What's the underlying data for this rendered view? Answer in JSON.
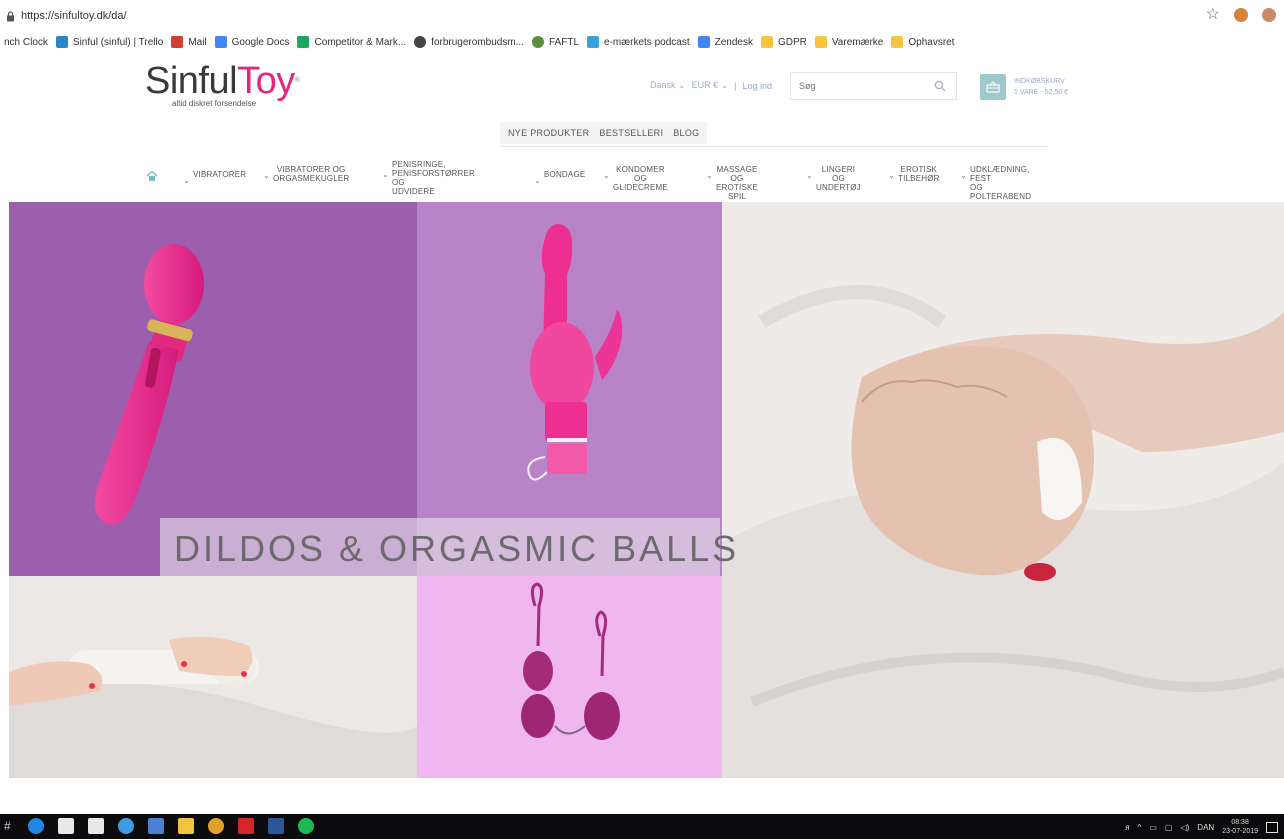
{
  "browser": {
    "url": "https://sinfultoy.dk/da/",
    "bookmarks": [
      {
        "label": "nch Clock",
        "color": "#ffffff"
      },
      {
        "label": "Sinful (sinful) | Trello",
        "color": "#2a85c9"
      },
      {
        "label": "Mail",
        "color": "#d23f31"
      },
      {
        "label": "Google Docs",
        "color": "#4285f4"
      },
      {
        "label": "Competitor & Mark...",
        "color": "#1fa463"
      },
      {
        "label": "forbrugerombudsm...",
        "color": "#444444"
      },
      {
        "label": "FAFTL",
        "color": "#5b8c3a"
      },
      {
        "label": "e-mærkets podcast",
        "color": "#3aa3d6"
      },
      {
        "label": "Zendesk",
        "color": "#4285f4"
      },
      {
        "label": "GDPR",
        "color": "#f5c542"
      },
      {
        "label": "Varemærke",
        "color": "#f5c542"
      },
      {
        "label": "Ophavsret",
        "color": "#f5c542"
      }
    ]
  },
  "header": {
    "logo_part1": "Sinful",
    "logo_part2": "Toy",
    "logo_reg": "®",
    "tagline": "altid diskret forsendelse",
    "language": "Dansk",
    "currency": "EUR €",
    "separator": "|",
    "login": "Log ind",
    "search_placeholder": "Søg",
    "cart_title": "INDKØBSKURV",
    "cart_summary": "1 VARE - 52,50 €"
  },
  "subnav": [
    "NYE PRODUKTER",
    "BESTSELLERI",
    "BLOG"
  ],
  "mainnav": [
    {
      "line1": "VIBRATORER",
      "line2": "",
      "line3": ""
    },
    {
      "line1": "VIBRATORER OG",
      "line2": "ORGASMEKUGLER",
      "line3": ""
    },
    {
      "line1": "PENISRINGE,",
      "line2": "PENISFORSTØRRER OG",
      "line3": "UDVIDERE"
    },
    {
      "line1": "BONDAGE",
      "line2": "",
      "line3": ""
    },
    {
      "line1": "KONDOMER OG",
      "line2": "GLIDECREME",
      "line3": ""
    },
    {
      "line1": "MASSAGE OG",
      "line2": "EROTISKE SPIL",
      "line3": ""
    },
    {
      "line1": "LINGERI OG",
      "line2": "UNDERTØJ",
      "line3": ""
    },
    {
      "line1": "EROTISK",
      "line2": "TILBEHØR",
      "line3": ""
    },
    {
      "line1": "UDKLÆDNING, FEST",
      "line2": "OG POLTERABEND",
      "line3": ""
    }
  ],
  "hero": {
    "title": "DILDOS & ORGASMIC BALLS"
  },
  "taskbar": {
    "lang": "DAN",
    "time": "08:38",
    "date": "23-07-2019"
  },
  "colors": {
    "brand_pink": "#e0287e",
    "panel_purple": "#9b5fad",
    "panel_lilac": "#b883c7",
    "panel_pink": "#efb6f2",
    "toy_pink": "#ee2f92",
    "balls_purple": "#a52a7b"
  }
}
